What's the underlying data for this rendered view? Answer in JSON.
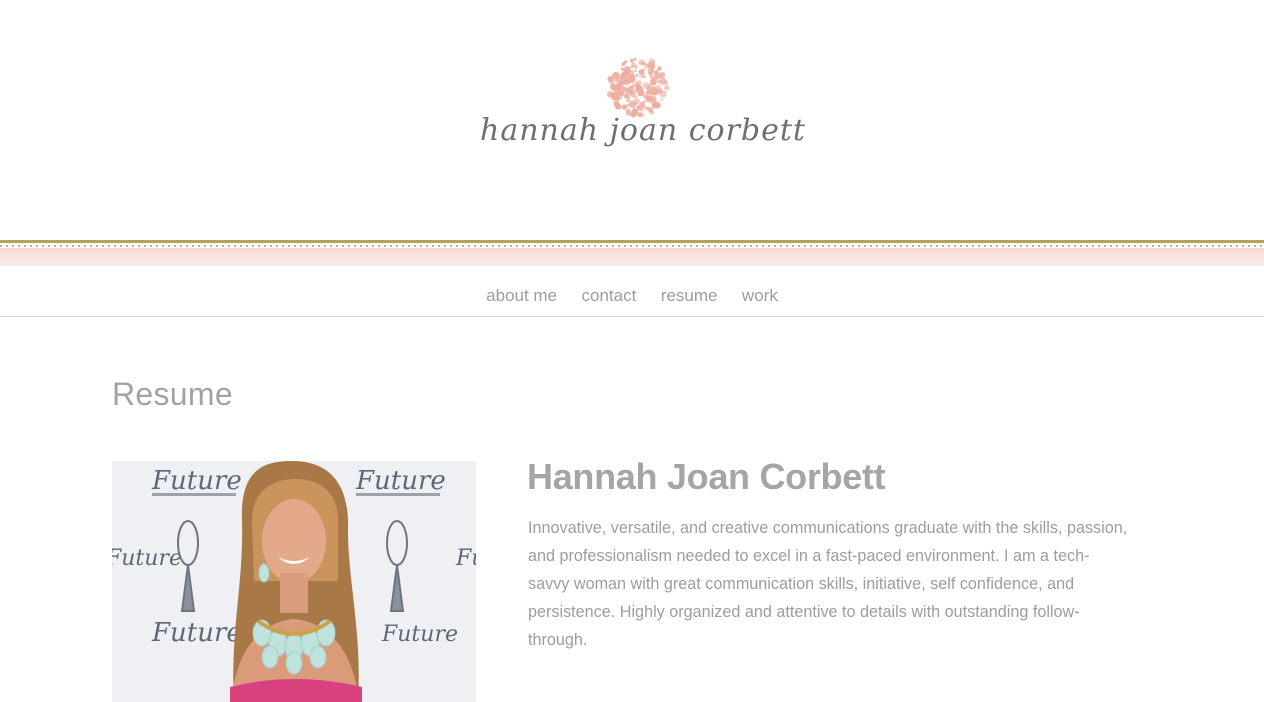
{
  "site": {
    "logo_text": "hannah joan corbett",
    "logo_icon": "dotted-circle-icon"
  },
  "nav": {
    "items": [
      {
        "label": "about me"
      },
      {
        "label": "contact"
      },
      {
        "label": "resume"
      },
      {
        "label": "work"
      }
    ]
  },
  "page": {
    "title": "Resume",
    "name": "Hannah Joan Corbett",
    "summary": "Innovative, versatile, and creative communications graduate with the skills, passion, and professionalism needed to excel in a fast-paced environment. I am a tech-savvy woman with great communication skills, initiative, self confidence, and persistence. Highly organized and attentive to details with outstanding follow-through.",
    "photo": {
      "backdrop_text": "Future"
    }
  },
  "colors": {
    "accent_pink": "#ecaea0",
    "gold_line": "#b3a25c",
    "text_gray": "#9b9b9b"
  }
}
